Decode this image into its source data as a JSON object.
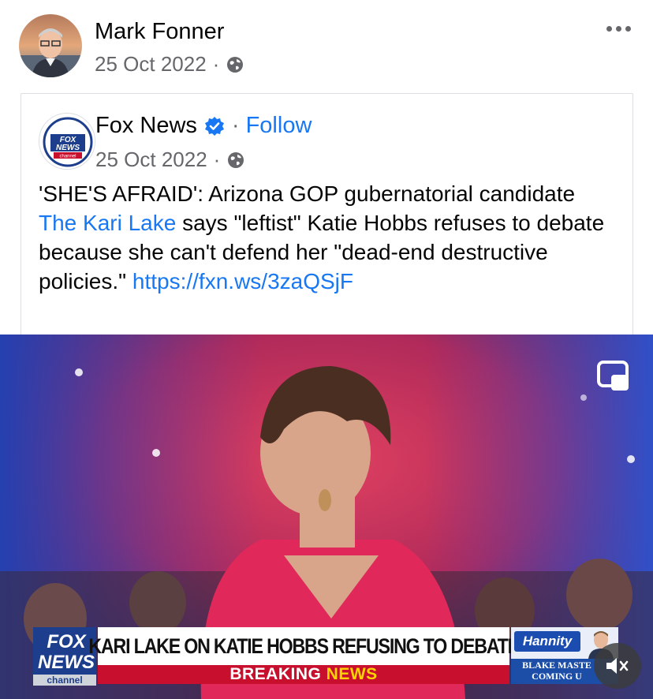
{
  "post": {
    "author_name": "Mark Fonner",
    "date": "25 Oct 2022",
    "separator": "·",
    "audience_icon": "globe-icon",
    "more_icon": "more-options-icon"
  },
  "shared": {
    "page_name": "Fox News",
    "verified_icon": "verified-badge-icon",
    "follow_separator": "·",
    "follow_label": "Follow",
    "date": "25 Oct 2022",
    "separator": "·",
    "text_part1": "'SHE'S AFRAID': Arizona GOP gubernatorial candidate ",
    "mention": "The Kari Lake",
    "text_part2": " says \"leftist\" Katie Hobbs refuses to debate because she can't defend her \"dead-end destructive policies.\" ",
    "link_text": "https://fxn.ws/3zaQSjF",
    "avatar_logo_line1": "FOX",
    "avatar_logo_line2": "NEWS",
    "avatar_logo_line3": "channel"
  },
  "video": {
    "chyron_logo_line1": "FOX",
    "chyron_logo_line2": "NEWS",
    "chyron_channel": "channel",
    "headline": "KARI LAKE ON KATIE HOBBS REFUSING TO DEBATE",
    "breaking_word": "BREAKING",
    "news_word": "NEWS",
    "promo_show": "Hannity",
    "promo_line1": "BLAKE MASTE",
    "promo_line2": "COMING U",
    "pip_icon": "picture-in-picture-icon",
    "mute_icon": "speaker-muted-icon"
  },
  "colors": {
    "link_blue": "#1877f2",
    "secondary_text": "#65676b",
    "breaking_red": "#c8102e",
    "fox_blue": "#1d3e8c"
  }
}
